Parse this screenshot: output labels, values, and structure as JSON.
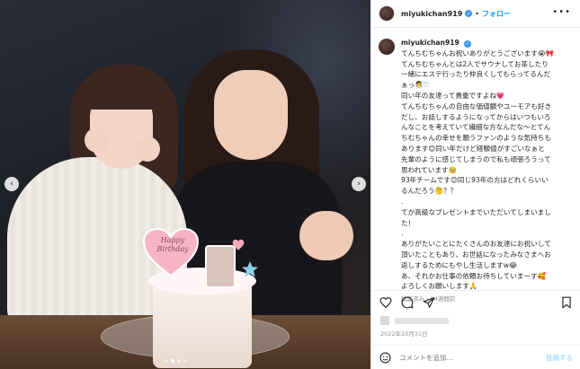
{
  "header": {
    "username": "miyukichan919",
    "separator": "•",
    "follow_label": "フォロー",
    "more_label": "•••"
  },
  "photo": {
    "heart_topper_text": "Happy Birthday",
    "nav_prev": "‹",
    "nav_next": "›",
    "carousel_count": 4,
    "carousel_active": 1
  },
  "caption": {
    "username": "miyukichan919",
    "lines": [
      "てんちむちゃんお祝いありがとうございます😭🎀",
      "てんちむちゃんとは2人でサウナしてお茶したり",
      "一緒にエステ行ったり仲良くしてもらってるんだ",
      "ぁっ🧖‍♀️♡",
      "同い年の友達って貴重ですよね💗",
      "てんちむちゃんの自由な価値観やユーモアも好き",
      "だし、お話しするようになってからはいつもいろ",
      "んなことを考えていて繊細な方なんだな〜とてん",
      "ちむちゃんの幸せを願うファンのような気持ちも",
      "あります😊同い年だけど経験値がすごいなぁと",
      "先輩のように感じてしまうので私も頑張ろうって",
      "思われています🥹",
      "93年チームです😊同じ93年の方はどれくらいい",
      "るんだろう🤔？？",
      ".",
      "てか高級なプレゼントまでいただいてしまいまし",
      "た！",
      ".",
      "ありがたいことにたくさんのお友達にお祝いして",
      "頂いたこともあり、お世話になったみなさまへお",
      "返しするためにもやし生活しますw😂",
      "あ、それかお仕事の依頼お待ちしていまーす🥰",
      "よろしくお願いします🙏"
    ],
    "meta": "編集済み・84週間前"
  },
  "actions": {
    "like_icon": "heart-icon",
    "comment_icon": "comment-icon",
    "share_icon": "share-icon",
    "save_icon": "bookmark-icon"
  },
  "date": "2022年10月31日",
  "comment_box": {
    "placeholder": "コメントを追加...",
    "post_label": "投稿する"
  },
  "colors": {
    "accent": "#0095f6",
    "verified": "#3897f0",
    "muted": "#8e8e8e"
  }
}
